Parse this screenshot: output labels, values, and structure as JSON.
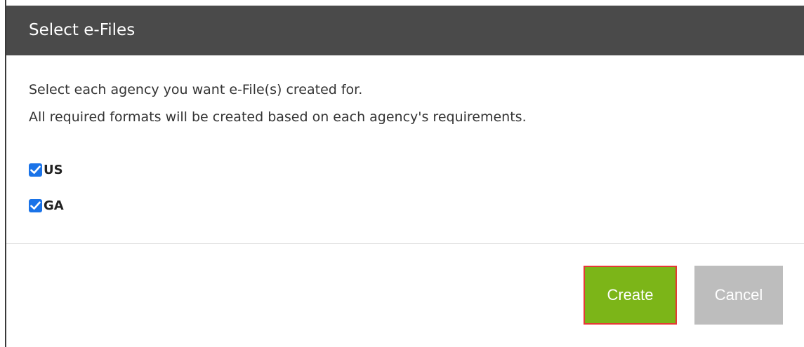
{
  "dialog": {
    "title": "Select e-Files",
    "instructions": [
      "Select each agency you want e-File(s) created for.",
      "All required formats will be created based on each agency's requirements."
    ],
    "agencies": [
      {
        "label": "US",
        "checked": true
      },
      {
        "label": "GA",
        "checked": true
      }
    ],
    "buttons": {
      "create_label": "Create",
      "cancel_label": "Cancel"
    }
  },
  "colors": {
    "header_bg": "#4a4a4a",
    "create_bg": "#7cb518",
    "create_highlight_border": "#e53935",
    "cancel_bg": "#bdbdbd",
    "checkbox_blue": "#1a73e8"
  },
  "icons": {
    "checkbox_checked": "check-icon"
  }
}
